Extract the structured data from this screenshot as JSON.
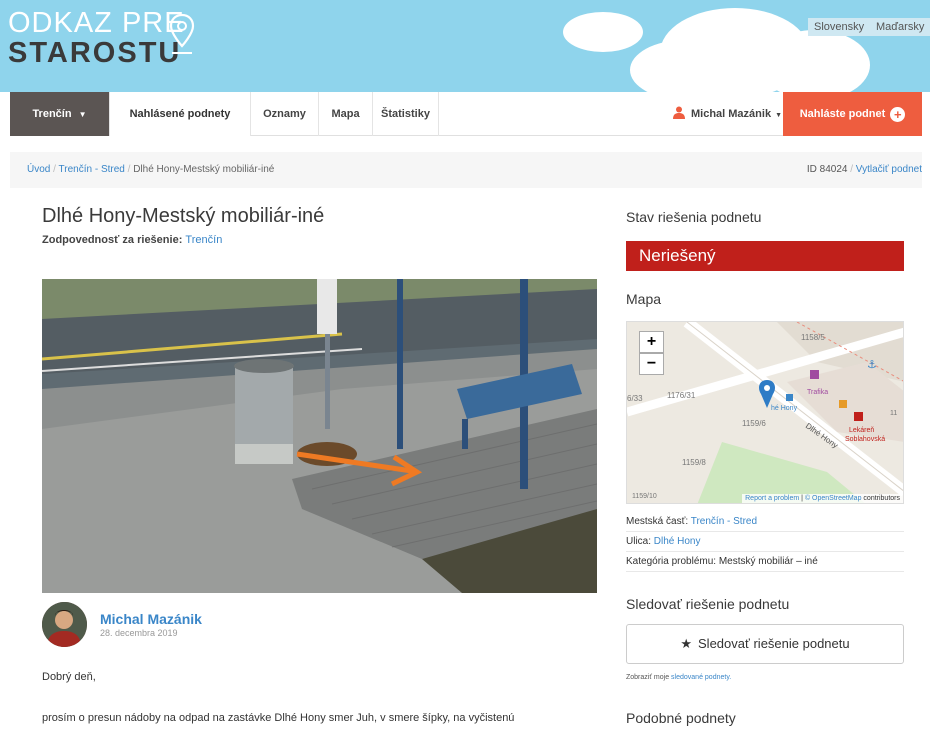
{
  "header": {
    "logo_line1": "ODKAZ PRE",
    "logo_line2": "STAROSTU",
    "lang_sk": "Slovensky",
    "lang_hu": "Maďarsky"
  },
  "nav": {
    "city": "Trenčín",
    "items": [
      "Nahlásené podnety",
      "Oznamy",
      "Mapa",
      "Štatistiky"
    ],
    "user": "Michal Mazánik",
    "report_button": "Nahláste podnet"
  },
  "breadcrumb": {
    "home": "Úvod",
    "district": "Trenčín - Stred",
    "current": "Dlhé Hony-Mestský mobiliár-iné",
    "id_label": "ID",
    "id_value": "84024",
    "print": "Vytlačiť podnet"
  },
  "issue": {
    "title": "Dlhé Hony-Mestský mobiliár-iné",
    "resp_label": "Zodpovednosť za riešenie:",
    "resp_value": "Trenčín",
    "author": "Michal Mazánik",
    "date": "28. decembra 2019",
    "greeting": "Dobrý deň,",
    "body": "prosím o presun nádoby na odpad na zastávke Dlhé Hony smer Juh, v smere šípky, na vyčistenú"
  },
  "sidebar": {
    "status_heading": "Stav riešenia podnetu",
    "status_value": "Neriešený",
    "map_heading": "Mapa",
    "map_labels": {
      "p1158_5": "1158/5",
      "p1176_31": "1176/31",
      "p633": "6/33",
      "p1159_6": "1159/6",
      "p1159_8": "1159/8",
      "p1159_10": "1159/10",
      "street": "Dlhé Hony",
      "bus": "hé Hony",
      "trafika": "Trafika",
      "lekaren1": "Lekáreň",
      "lekaren2": "Soblahovská",
      "edge": "11"
    },
    "attrib_report": "Report a problem",
    "attrib_osm": "© OpenStreetMap",
    "attrib_contrib": "contributors",
    "district_label": "Mestská časť:",
    "district_value": "Trenčín - Stred",
    "street_label": "Ulica:",
    "street_value": "Dlhé Hony",
    "category_label": "Kategória problému:",
    "category_value": "Mestský mobiliár – iné",
    "follow_heading": "Sledovať riešenie podnetu",
    "follow_button": "Sledovať riešenie podnetu",
    "show_text": "Zobraziť moje",
    "show_link": "sledované podnety.",
    "similar_heading": "Podobné podnety"
  }
}
